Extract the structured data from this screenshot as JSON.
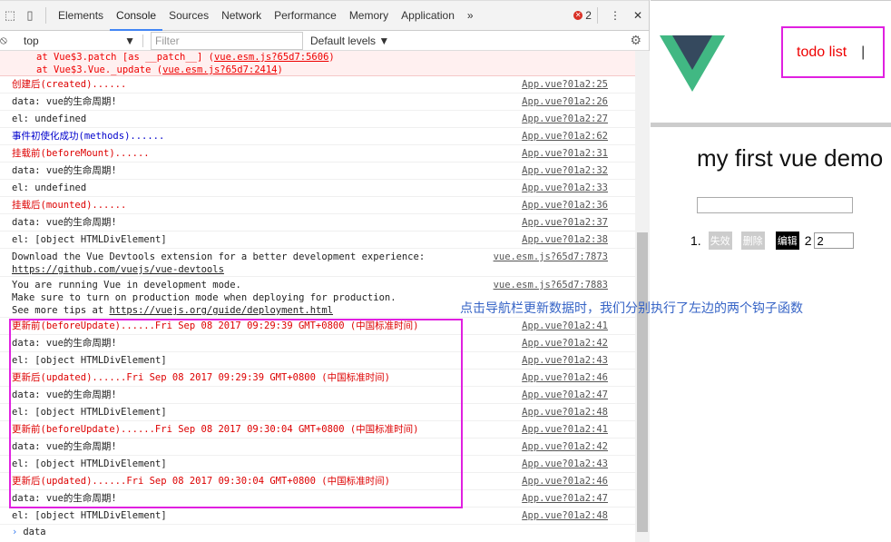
{
  "devtools": {
    "tabs": [
      "Elements",
      "Console",
      "Sources",
      "Network",
      "Performance",
      "Memory",
      "Application"
    ],
    "active_tab": "Console",
    "more": "»",
    "error_count": "2",
    "menu": "⋮",
    "close": "✕",
    "context": "top",
    "filter_placeholder": "Filter",
    "levels": "Default levels ▼"
  },
  "console": {
    "error_lines": [
      {
        "text": "at Vue$3.patch [as __patch__] (",
        "link": "vue.esm.js?65d7:5606",
        "end": ")"
      },
      {
        "text": "at Vue$3.Vue._update (",
        "link": "vue.esm.js?65d7:2414",
        "end": ")"
      }
    ],
    "rows": [
      {
        "msg": "创建后(created)......",
        "src": "App.vue?01a2:25",
        "color": "red"
      },
      {
        "msg": "data: vue的生命周期!",
        "src": "App.vue?01a2:26",
        "color": "dark"
      },
      {
        "msg": "el: undefined",
        "src": "App.vue?01a2:27",
        "color": "dark"
      },
      {
        "msg": "事件初使化成功(methods)......",
        "src": "App.vue?01a2:62",
        "color": "blue"
      },
      {
        "msg": "挂载前(beforeMount)......",
        "src": "App.vue?01a2:31",
        "color": "red"
      },
      {
        "msg": "data: vue的生命周期!",
        "src": "App.vue?01a2:32",
        "color": "dark"
      },
      {
        "msg": "el: undefined",
        "src": "App.vue?01a2:33",
        "color": "dark"
      },
      {
        "msg": "挂载后(mounted)......",
        "src": "App.vue?01a2:36",
        "color": "red"
      },
      {
        "msg": "data: vue的生命周期!",
        "src": "App.vue?01a2:37",
        "color": "dark"
      },
      {
        "msg": "el: [object HTMLDivElement]",
        "src": "App.vue?01a2:38",
        "color": "dark"
      },
      {
        "msg": "Download the Vue Devtools extension for a better development experience:",
        "link": "https://github.com/vuejs/vue-devtools",
        "src": "vue.esm.js?65d7:7873",
        "color": "dark"
      },
      {
        "msg": "You are running Vue in development mode.\nMake sure to turn on production mode when deploying for production.\nSee more tips at ",
        "link": "https://vuejs.org/guide/deployment.html",
        "src": "vue.esm.js?65d7:7883",
        "color": "dark"
      },
      {
        "msg": "更新前(beforeUpdate)......Fri Sep 08 2017 09:29:39 GMT+0800 (中国标准时间)",
        "src": "App.vue?01a2:41",
        "color": "red"
      },
      {
        "msg": "data: vue的生命周期!",
        "src": "App.vue?01a2:42",
        "color": "dark"
      },
      {
        "msg": "el: [object HTMLDivElement]",
        "src": "App.vue?01a2:43",
        "color": "dark"
      },
      {
        "msg": "更新后(updated)......Fri Sep 08 2017 09:29:39 GMT+0800 (中国标准时间)",
        "src": "App.vue?01a2:46",
        "color": "red"
      },
      {
        "msg": "data: vue的生命周期!",
        "src": "App.vue?01a2:47",
        "color": "dark"
      },
      {
        "msg": "el: [object HTMLDivElement]",
        "src": "App.vue?01a2:48",
        "color": "dark"
      },
      {
        "msg": "更新前(beforeUpdate)......Fri Sep 08 2017 09:30:04 GMT+0800 (中国标准时间)",
        "src": "App.vue?01a2:41",
        "color": "red"
      },
      {
        "msg": "data: vue的生命周期!",
        "src": "App.vue?01a2:42",
        "color": "dark"
      },
      {
        "msg": "el: [object HTMLDivElement]",
        "src": "App.vue?01a2:43",
        "color": "dark"
      },
      {
        "msg": "更新后(updated)......Fri Sep 08 2017 09:30:04 GMT+0800 (中国标准时间)",
        "src": "App.vue?01a2:46",
        "color": "red"
      },
      {
        "msg": "data: vue的生命周期!",
        "src": "App.vue?01a2:47",
        "color": "dark"
      },
      {
        "msg": "el: [object HTMLDivElement]",
        "src": "App.vue?01a2:48",
        "color": "dark"
      }
    ],
    "prompt": "data"
  },
  "annotation": "点击导航栏更新数据时，我们分别执行了左边的两个钩子函数",
  "page": {
    "nav": "todo list",
    "nav_sep": "|",
    "title": "my first vue demo",
    "item_index": "1.",
    "btn_invalid": "失效",
    "btn_delete": "删除",
    "btn_edit": "编辑",
    "item_text": "2",
    "item_input": "2"
  },
  "colors": {
    "vue_green": "#41b883",
    "vue_dark": "#35495e",
    "highlight": "#e020e0"
  }
}
